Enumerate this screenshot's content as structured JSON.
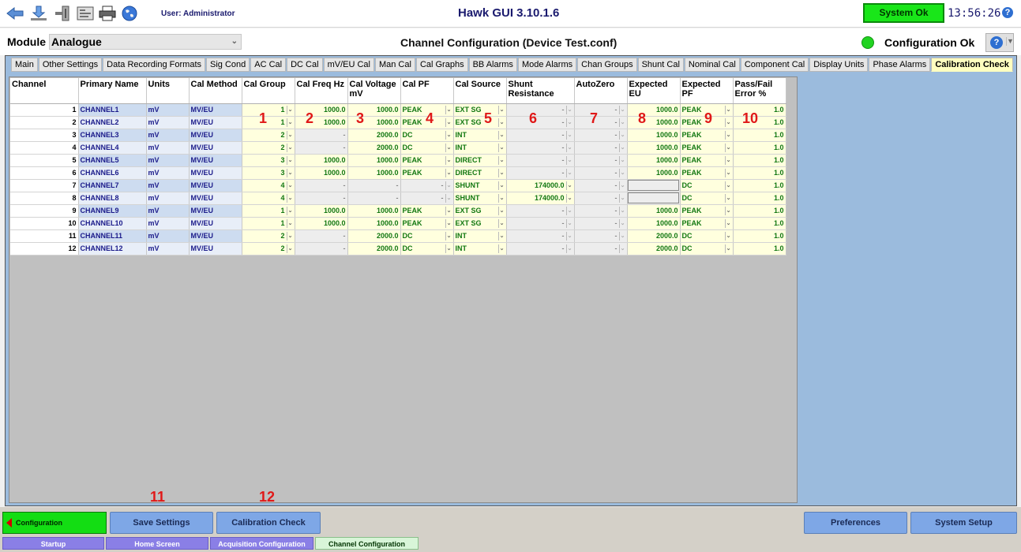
{
  "toolbar": {
    "icons": [
      "back-arrow-icon",
      "download-icon",
      "plug-icon",
      "calibrate-icon",
      "printer-icon",
      "globe-icon"
    ],
    "user": "User: Administrator",
    "title": "Hawk GUI 3.10.1.6",
    "system_status": "System Ok",
    "clock": "13:56:26"
  },
  "module": {
    "label": "Module",
    "value": "Analogue",
    "page_title": "Channel Configuration (Device Test.conf)",
    "config_status": "Configuration Ok"
  },
  "tabs": [
    "Main",
    "Other Settings",
    "Data Recording Formats",
    "Sig Cond",
    "AC Cal",
    "DC Cal",
    "mV/EU Cal",
    "Man Cal",
    "Cal Graphs",
    "BB Alarms",
    "Mode Alarms",
    "Chan Groups",
    "Shunt Cal",
    "Nominal Cal",
    "Component Cal",
    "Display Units",
    "Phase Alarms",
    "Calibration Check"
  ],
  "active_tab": "Calibration Check",
  "headers": [
    "Channel",
    "Primary Name",
    "Units",
    "Cal Method",
    "Cal Group",
    "Cal Freq Hz",
    "Cal Voltage mV",
    "Cal PF",
    "Cal Source",
    "Shunt Resistance",
    "AutoZero",
    "Expected EU",
    "Expected PF",
    "Pass/Fail Error %"
  ],
  "rows": [
    {
      "ch": "1",
      "name": "CHANNEL1",
      "units": "mV",
      "method": "MV/EU",
      "group": "1",
      "freq": "1000.0",
      "volt": "1000.0",
      "pf": "PEAK",
      "source": "EXT SG",
      "shunt": "-",
      "az": "-",
      "eu": "1000.0",
      "epf": "PEAK",
      "err": "1.0"
    },
    {
      "ch": "2",
      "name": "CHANNEL2",
      "units": "mV",
      "method": "MV/EU",
      "group": "1",
      "freq": "1000.0",
      "volt": "1000.0",
      "pf": "PEAK",
      "source": "EXT SG",
      "shunt": "-",
      "az": "-",
      "eu": "1000.0",
      "epf": "PEAK",
      "err": "1.0"
    },
    {
      "ch": "3",
      "name": "CHANNEL3",
      "units": "mV",
      "method": "MV/EU",
      "group": "2",
      "freq": "-",
      "volt": "2000.0",
      "pf": "DC",
      "source": "INT",
      "shunt": "-",
      "az": "-",
      "eu": "1000.0",
      "epf": "PEAK",
      "err": "1.0"
    },
    {
      "ch": "4",
      "name": "CHANNEL4",
      "units": "mV",
      "method": "MV/EU",
      "group": "2",
      "freq": "-",
      "volt": "2000.0",
      "pf": "DC",
      "source": "INT",
      "shunt": "-",
      "az": "-",
      "eu": "1000.0",
      "epf": "PEAK",
      "err": "1.0"
    },
    {
      "ch": "5",
      "name": "CHANNEL5",
      "units": "mV",
      "method": "MV/EU",
      "group": "3",
      "freq": "1000.0",
      "volt": "1000.0",
      "pf": "PEAK",
      "source": "DIRECT",
      "shunt": "-",
      "az": "-",
      "eu": "1000.0",
      "epf": "PEAK",
      "err": "1.0"
    },
    {
      "ch": "6",
      "name": "CHANNEL6",
      "units": "mV",
      "method": "MV/EU",
      "group": "3",
      "freq": "1000.0",
      "volt": "1000.0",
      "pf": "PEAK",
      "source": "DIRECT",
      "shunt": "-",
      "az": "-",
      "eu": "1000.0",
      "epf": "PEAK",
      "err": "1.0"
    },
    {
      "ch": "7",
      "name": "CHANNEL7",
      "units": "mV",
      "method": "MV/EU",
      "group": "4",
      "freq": "-",
      "volt": "-",
      "pf": "-",
      "source": "SHUNT",
      "shunt": "174000.0",
      "az": "-",
      "eu": "",
      "epf": "DC",
      "err": "1.0"
    },
    {
      "ch": "8",
      "name": "CHANNEL8",
      "units": "mV",
      "method": "MV/EU",
      "group": "4",
      "freq": "-",
      "volt": "-",
      "pf": "-",
      "source": "SHUNT",
      "shunt": "174000.0",
      "az": "-",
      "eu": "",
      "epf": "DC",
      "err": "1.0"
    },
    {
      "ch": "9",
      "name": "CHANNEL9",
      "units": "mV",
      "method": "MV/EU",
      "group": "1",
      "freq": "1000.0",
      "volt": "1000.0",
      "pf": "PEAK",
      "source": "EXT SG",
      "shunt": "-",
      "az": "-",
      "eu": "1000.0",
      "epf": "PEAK",
      "err": "1.0"
    },
    {
      "ch": "10",
      "name": "CHANNEL10",
      "units": "mV",
      "method": "MV/EU",
      "group": "1",
      "freq": "1000.0",
      "volt": "1000.0",
      "pf": "PEAK",
      "source": "EXT SG",
      "shunt": "-",
      "az": "-",
      "eu": "1000.0",
      "epf": "PEAK",
      "err": "1.0"
    },
    {
      "ch": "11",
      "name": "CHANNEL11",
      "units": "mV",
      "method": "MV/EU",
      "group": "2",
      "freq": "-",
      "volt": "2000.0",
      "pf": "DC",
      "source": "INT",
      "shunt": "-",
      "az": "-",
      "eu": "2000.0",
      "epf": "DC",
      "err": "1.0"
    },
    {
      "ch": "12",
      "name": "CHANNEL12",
      "units": "mV",
      "method": "MV/EU",
      "group": "2",
      "freq": "-",
      "volt": "2000.0",
      "pf": "DC",
      "source": "INT",
      "shunt": "-",
      "az": "-",
      "eu": "2000.0",
      "epf": "DC",
      "err": "1.0"
    }
  ],
  "annotations": [
    "1",
    "2",
    "3",
    "4",
    "5",
    "6",
    "7",
    "8",
    "9",
    "10",
    "11",
    "12"
  ],
  "bottom": {
    "configuration": "Configuration",
    "save_settings": "Save Settings",
    "calibration_check": "Calibration Check",
    "preferences": "Preferences",
    "system_setup": "System Setup"
  },
  "crumbs": [
    "Startup",
    "Home Screen",
    "Acquisition Configuration",
    "Channel Configuration"
  ],
  "colors": {
    "status_green": "#19e619",
    "editable": "#ffffde",
    "annotation": "#e01818",
    "nav_blue": "#7ea7e6"
  }
}
